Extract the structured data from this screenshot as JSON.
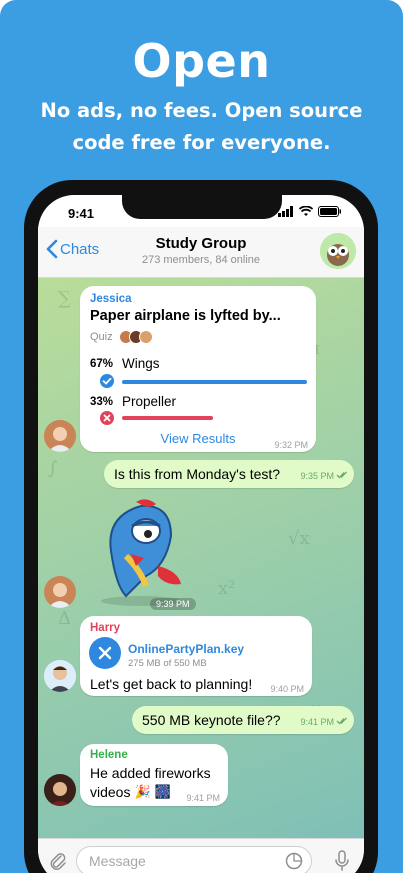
{
  "promo": {
    "headline": "Open",
    "subline": "No ads, no fees. Open source code free for everyone."
  },
  "status": {
    "time": "9:41"
  },
  "nav": {
    "back_label": "Chats",
    "title": "Study Group",
    "subtitle": "273 members, 84 online"
  },
  "poll": {
    "sender": "Jessica",
    "question": "Paper airplane is lyfted by...",
    "type": "Quiz",
    "options": [
      {
        "percent": "67%",
        "label": "Wings",
        "fraction": 0.67
      },
      {
        "percent": "33%",
        "label": "Propeller",
        "fraction": 0.33
      }
    ],
    "results_label": "View Results",
    "time": "9:32 PM"
  },
  "msg_monday": {
    "text": "Is this from Monday's test?",
    "time": "9:35 PM"
  },
  "sticker": {
    "time": "9:39 PM"
  },
  "harry": {
    "sender": "Harry",
    "file_name": "OnlinePartyPlan.key",
    "file_progress": "275 MB of 550 MB",
    "text": "Let's get back to planning!",
    "time": "9:40 PM"
  },
  "msg_keynote": {
    "text": "550 MB keynote file??",
    "time": "9:41 PM"
  },
  "helene": {
    "sender": "Helene",
    "text_line1": "He added fireworks",
    "text_line2": "videos",
    "time": "9:41 PM"
  },
  "input": {
    "placeholder": "Message"
  },
  "colors": {
    "promo_bg": "#3b9de2",
    "accent_blue": "#2f88df",
    "poll_sender": "#2f88df",
    "harry_sender": "#e0435a",
    "helene_sender": "#35b04a",
    "wrong_red": "#e0435a",
    "outgoing_bubble": "#e1fbc8"
  }
}
